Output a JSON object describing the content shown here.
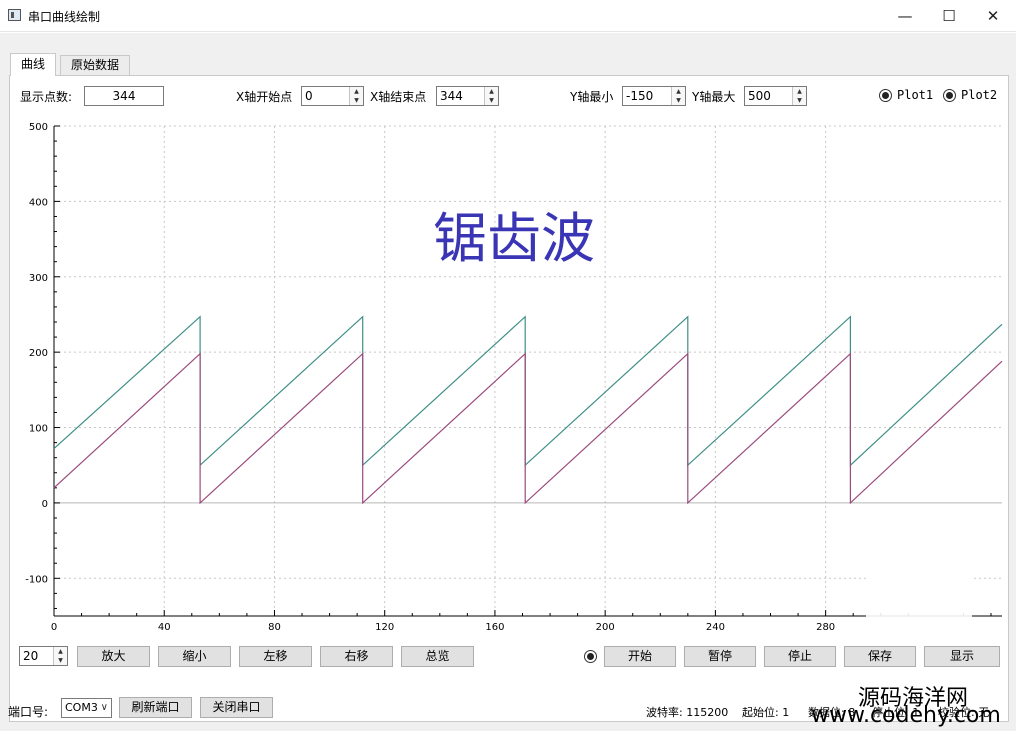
{
  "window": {
    "title": "串口曲线绘制",
    "minimize": "—",
    "maximize": "☐",
    "close": "✕"
  },
  "tabs": [
    {
      "label": "曲线"
    },
    {
      "label": "原始数据"
    }
  ],
  "controls": {
    "points_label": "显示点数:",
    "points_value": "344",
    "x_start_label": "X轴开始点",
    "x_start_value": "0",
    "x_end_label": "X轴结束点",
    "x_end_value": "344",
    "y_min_label": "Y轴最小",
    "y_min_value": "-150",
    "y_max_label": "Y轴最大",
    "y_max_value": "500",
    "plot1_label": "Plot1",
    "plot2_label": "Plot2"
  },
  "bottom_bar": {
    "step_value": "20",
    "zoom_in": "放大",
    "zoom_out": "缩小",
    "move_left": "左移",
    "move_right": "右移",
    "overview": "总览",
    "start": "开始",
    "pause": "暂停",
    "stop": "停止",
    "save": "保存",
    "display": "显示"
  },
  "serial": {
    "port_label": "端口号:",
    "port_value": "COM3",
    "refresh": "刷新端口",
    "close_port": "关闭串口",
    "baud_text": "波特率: 115200",
    "start_bit_text": "起始位: 1",
    "data_bits_text": "数据位: 8",
    "stop_bits_text": "停止位: 1",
    "parity_text": "校验位: 无"
  },
  "overlay_title": "锯齿波",
  "watermark": {
    "cn": "源码海洋网",
    "url": "www.codehy.com"
  },
  "chart_data": {
    "type": "line",
    "xlim": [
      0,
      344
    ],
    "ylim": [
      -150,
      500
    ],
    "x_ticks": [
      0,
      40,
      80,
      120,
      160,
      200,
      240,
      280
    ],
    "y_ticks": [
      -100,
      0,
      100,
      200,
      300,
      400,
      500
    ],
    "grid": true,
    "colors": {
      "plot1": "#3f8f86",
      "plot2": "#9b4a7d",
      "zero_line": "#b8b8b8",
      "grid": "#c8c8c8"
    },
    "series": [
      {
        "x": [
          0,
          53,
          53,
          112,
          112,
          171,
          171,
          230,
          230,
          289,
          289,
          344
        ],
        "y": [
          72,
          247,
          50,
          247,
          50,
          247,
          50,
          247,
          50,
          247,
          50,
          237
        ]
      },
      {
        "x": [
          0,
          53,
          53,
          112,
          112,
          171,
          171,
          230,
          230,
          289,
          289,
          344
        ],
        "y": [
          20,
          198,
          0,
          198,
          0,
          198,
          0,
          198,
          0,
          198,
          0,
          188
        ]
      }
    ]
  }
}
